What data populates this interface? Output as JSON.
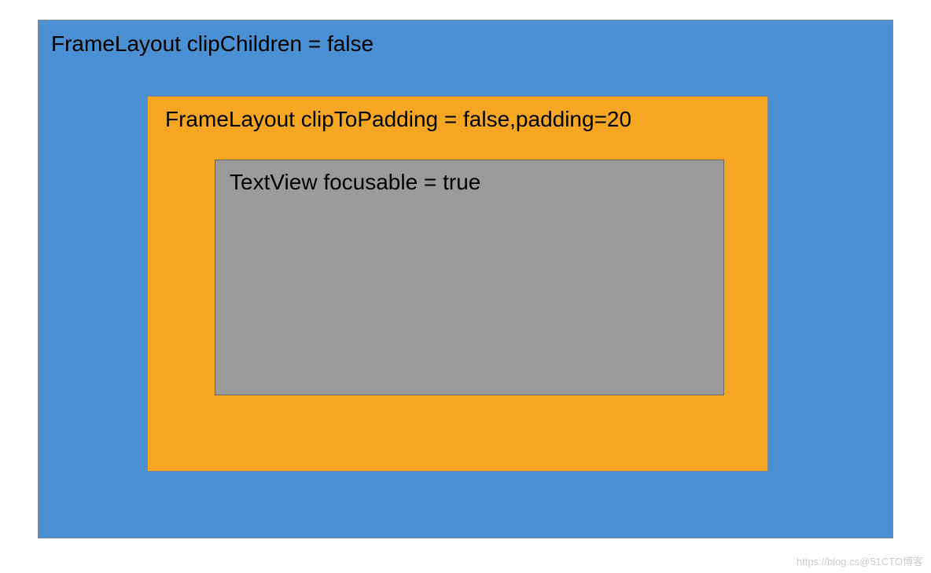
{
  "diagram": {
    "outer": {
      "label": "FrameLayout  clipChildren = false",
      "component": "FrameLayout",
      "attribute": "clipChildren",
      "value": "false",
      "background_color": "#4a90d2"
    },
    "middle": {
      "label": "FrameLayout  clipToPadding = false,padding=20",
      "component": "FrameLayout",
      "attributes": [
        {
          "name": "clipToPadding",
          "value": "false"
        },
        {
          "name": "padding",
          "value": "20"
        }
      ],
      "background_color": "#f5a623"
    },
    "inner": {
      "label": "TextView  focusable = true",
      "component": "TextView",
      "attribute": "focusable",
      "value": "true",
      "background_color": "#9b9b9b"
    }
  },
  "watermark": "https://blog.cs@51CTO博客"
}
